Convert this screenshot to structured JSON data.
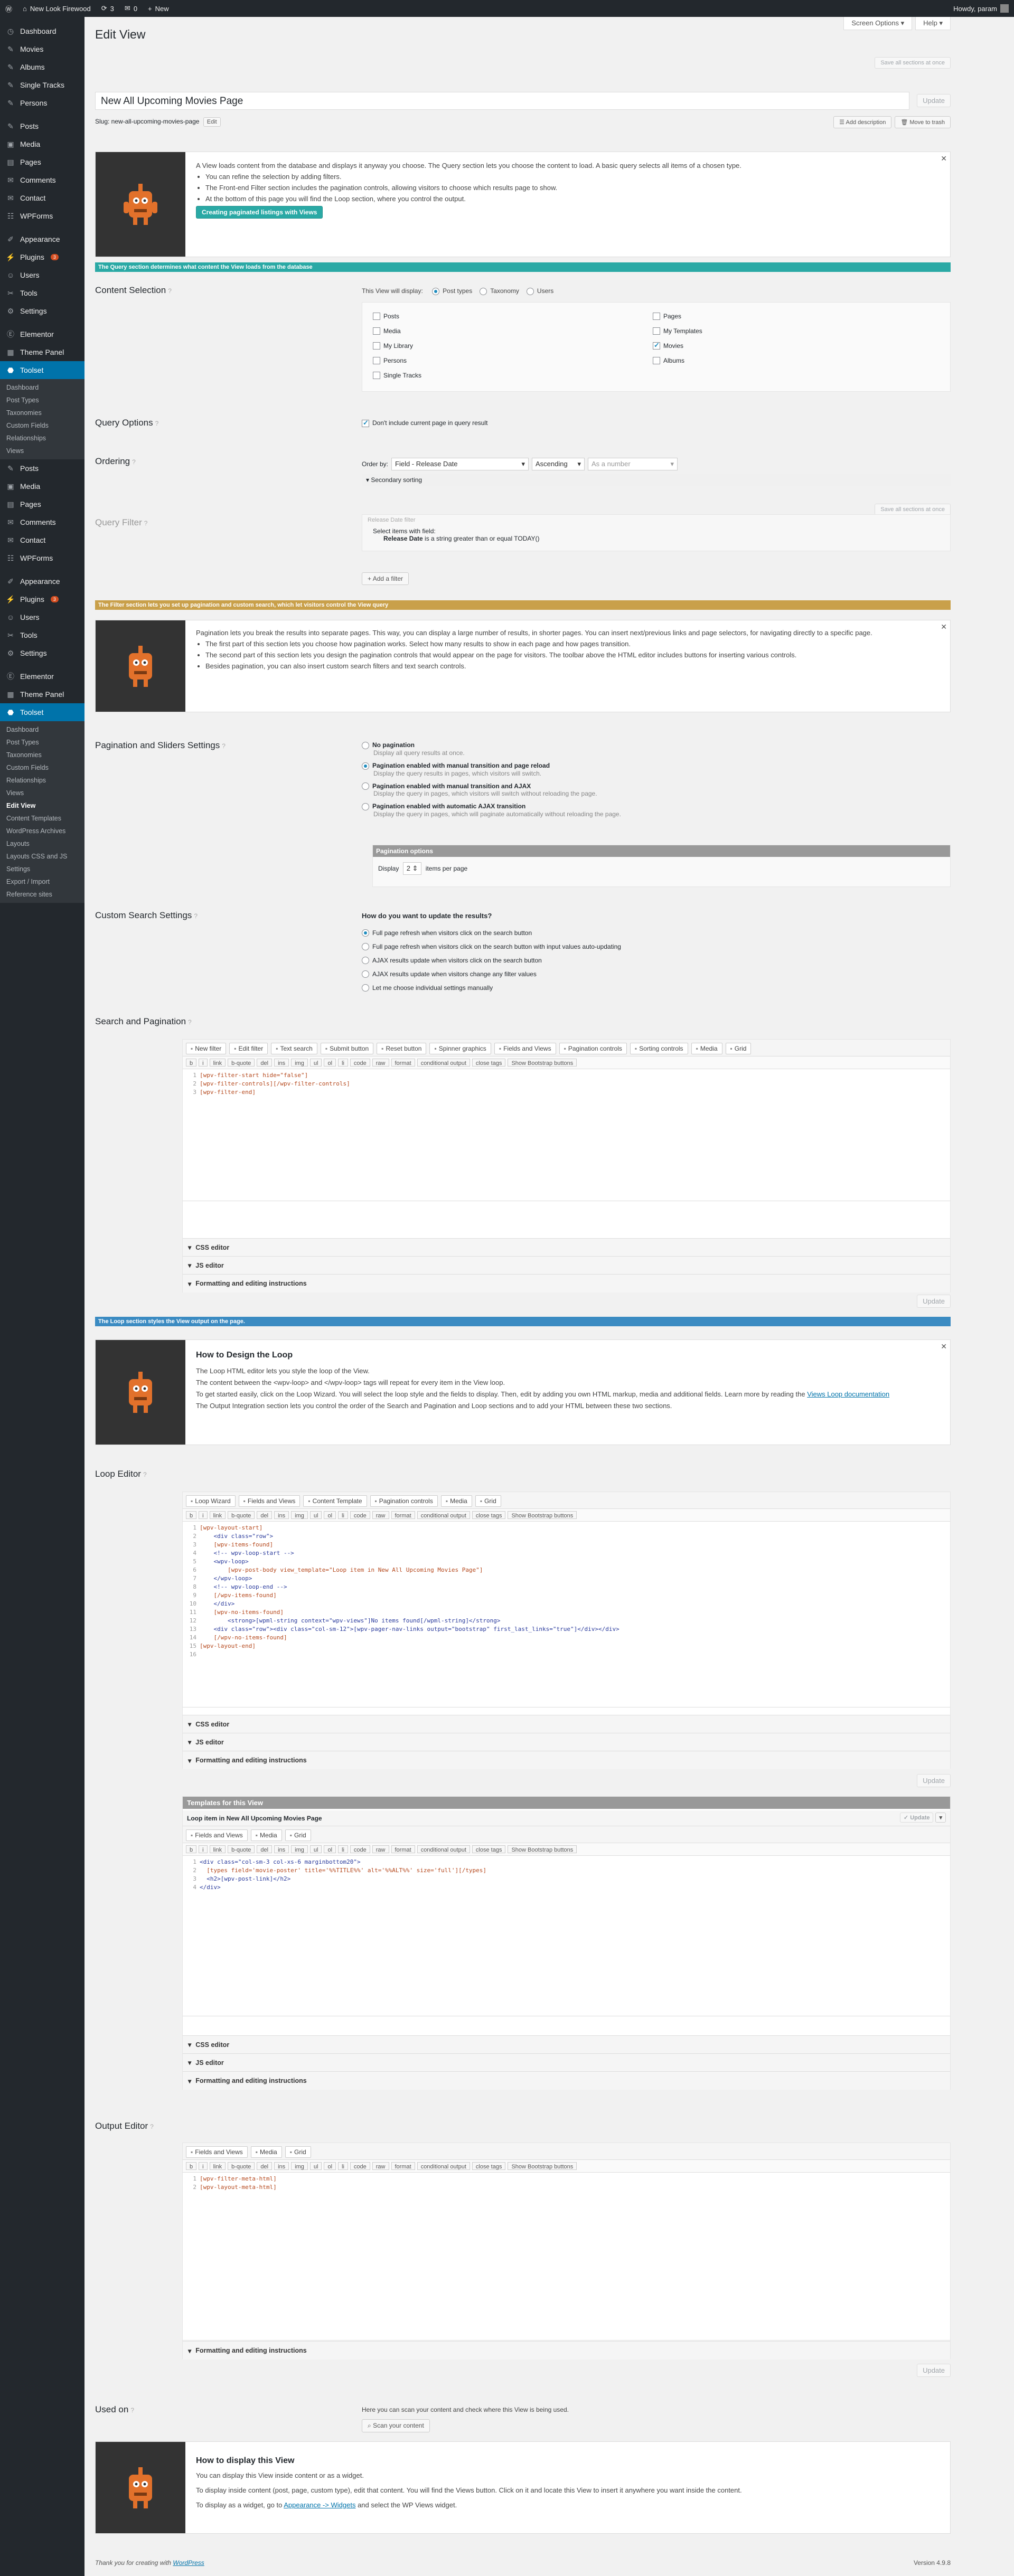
{
  "adminbar": {
    "site": "New Look Firewood",
    "updates": "3",
    "comments": "0",
    "new": "New",
    "howdy": "Howdy, param"
  },
  "menu": {
    "top": [
      {
        "label": "Dashboard",
        "icon": "dashboard-icon"
      },
      {
        "label": "Movies",
        "icon": "pin-icon"
      },
      {
        "label": "Albums",
        "icon": "pin-icon"
      },
      {
        "label": "Single Tracks",
        "icon": "pin-icon"
      },
      {
        "label": "Persons",
        "icon": "pin-icon"
      },
      {
        "label": "Posts",
        "icon": "pin-icon"
      },
      {
        "label": "Media",
        "icon": "media-icon"
      },
      {
        "label": "Pages",
        "icon": "page-icon"
      },
      {
        "label": "Comments",
        "icon": "comment-icon"
      },
      {
        "label": "Contact",
        "icon": "mail-icon"
      },
      {
        "label": "WPForms",
        "icon": "form-icon"
      },
      {
        "label": "Appearance",
        "icon": "brush-icon"
      },
      {
        "label": "Plugins",
        "icon": "plug-icon",
        "badge": "3"
      },
      {
        "label": "Users",
        "icon": "user-icon"
      },
      {
        "label": "Tools",
        "icon": "wrench-icon"
      },
      {
        "label": "Settings",
        "icon": "settings-icon"
      },
      {
        "label": "Elementor",
        "icon": "elementor-icon"
      },
      {
        "label": "Theme Panel",
        "icon": "panel-icon"
      },
      {
        "label": "Toolset",
        "icon": "toolset-icon"
      }
    ],
    "toolset_sub1": [
      "Dashboard",
      "Post Types",
      "Taxonomies",
      "Custom Fields",
      "Relationships",
      "Views"
    ],
    "mid": [
      {
        "label": "Posts",
        "icon": "pin-icon"
      },
      {
        "label": "Media",
        "icon": "media-icon"
      },
      {
        "label": "Pages",
        "icon": "page-icon"
      },
      {
        "label": "Comments",
        "icon": "comment-icon"
      },
      {
        "label": "Contact",
        "icon": "mail-icon"
      },
      {
        "label": "WPForms",
        "icon": "form-icon"
      },
      {
        "label": "Appearance",
        "icon": "brush-icon"
      },
      {
        "label": "Plugins",
        "icon": "plug-icon",
        "badge": "3"
      },
      {
        "label": "Users",
        "icon": "user-icon"
      },
      {
        "label": "Tools",
        "icon": "wrench-icon"
      },
      {
        "label": "Settings",
        "icon": "settings-icon"
      },
      {
        "label": "Elementor",
        "icon": "elementor-icon"
      },
      {
        "label": "Theme Panel",
        "icon": "panel-icon"
      },
      {
        "label": "Toolset",
        "icon": "toolset-icon"
      }
    ],
    "toolset_sub2": [
      "Dashboard",
      "Post Types",
      "Taxonomies",
      "Custom Fields",
      "Relationships",
      "Views",
      "Edit View",
      "Content Templates",
      "WordPress Archives",
      "Layouts",
      "Layouts CSS and JS",
      "Settings",
      "Export / Import",
      "Reference sites"
    ]
  },
  "header": {
    "screen_options": "Screen Options",
    "help": "Help",
    "page_title": "Edit View",
    "save_all": "Save all sections at once",
    "view_title": "New All Upcoming Movies Page",
    "update": "Update",
    "slug_label": "Slug: new-all-upcoming-movies-page",
    "edit": "Edit",
    "add_description": "Add description",
    "move_trash": "Move to trash"
  },
  "intro": {
    "text": "A View loads content from the database and displays it anyway you choose. The Query section lets you choose the content to load. A basic query selects all items of a chosen type.",
    "bullets": [
      "You can refine the selection by adding filters.",
      "The Front-end Filter section includes the pagination controls, allowing visitors to choose which results page to show.",
      "At the bottom of this page you will find the Loop section, where you control the output."
    ],
    "button": "Creating paginated listings with Views"
  },
  "bars": {
    "query": "The Query section determines what content the View loads from the database",
    "filter": "The Filter section lets you set up pagination and custom search, which let visitors control the View query",
    "loop": "The Loop section styles the View output on the page."
  },
  "content_selection": {
    "title": "Content Selection",
    "display_label": "This View will display:",
    "modes": [
      "Post types",
      "Taxonomy",
      "Users"
    ],
    "left": [
      {
        "label": "Posts",
        "on": false
      },
      {
        "label": "Media",
        "on": false
      },
      {
        "label": "My Library",
        "on": false
      },
      {
        "label": "Persons",
        "on": false
      },
      {
        "label": "Single Tracks",
        "on": false
      }
    ],
    "right": [
      {
        "label": "Pages",
        "on": false
      },
      {
        "label": "My Templates",
        "on": false
      },
      {
        "label": "Movies",
        "on": true
      },
      {
        "label": "Albums",
        "on": false
      }
    ]
  },
  "query_options": {
    "title": "Query Options",
    "checkbox": "Don't include current page in query result"
  },
  "ordering": {
    "title": "Ordering",
    "order_by": "Order by:",
    "field": "Field - Release Date",
    "direction": "Ascending",
    "as": "As a number",
    "secondary": "Secondary sorting"
  },
  "query_filter": {
    "title": "Query Filter",
    "save_all": "Save all sections at once",
    "filter_heading": "Release Date filter",
    "select_items": "Select items with field:",
    "filter_field": "Release Date",
    "filter_text": " is a string greater than or equal TODAY()",
    "add_filter": "Add a filter"
  },
  "pagination_help": {
    "text": "Pagination lets you break the results into separate pages. This way, you can display a large number of results, in shorter pages. You can insert next/previous links and page selectors, for navigating directly to a specific page.",
    "bullets": [
      "The first part of this section lets you choose how pagination works. Select how many results to show in each page and how pages transition.",
      "The second part of this section lets you design the pagination controls that would appear on the page for visitors. The toolbar above the HTML editor includes buttons for inserting various controls.",
      "Besides pagination, you can also insert custom search filters and text search controls."
    ]
  },
  "pagination": {
    "title": "Pagination and Sliders Settings",
    "options": [
      {
        "label": "No pagination",
        "desc": "Display all query results at once.",
        "on": false
      },
      {
        "label": "Pagination enabled with manual transition and page reload",
        "desc": "Display the query results in pages, which visitors will switch.",
        "on": true
      },
      {
        "label": "Pagination enabled with manual transition and AJAX",
        "desc": "Display the query in pages, which visitors will switch without reloading the page.",
        "on": false
      },
      {
        "label": "Pagination enabled with automatic AJAX transition",
        "desc": "Display the query in pages, which will paginate automatically without reloading the page.",
        "on": false
      }
    ],
    "options_title": "Pagination options",
    "display": "Display",
    "per_page": "2",
    "items_per_page": "items per page"
  },
  "custom_search": {
    "title": "Custom Search Settings",
    "question": "How do you want to update the results?",
    "options": [
      {
        "label": "Full page refresh when visitors click on the search button",
        "on": true
      },
      {
        "label": "Full page refresh when visitors click on the search button with input values auto-updating",
        "on": false
      },
      {
        "label": "AJAX results update when visitors click on the search button",
        "on": false
      },
      {
        "label": "AJAX results update when visitors change any filter values",
        "on": false
      },
      {
        "label": "Let me choose individual settings manually",
        "on": false
      }
    ]
  },
  "search_pagination": {
    "title": "Search and Pagination",
    "toolbar": [
      "New filter",
      "Edit filter",
      "Text search",
      "Submit button",
      "Reset button",
      "Spinner graphics",
      "Fields and Views",
      "Pagination controls",
      "Sorting controls",
      "Media",
      "Grid"
    ],
    "quicktags": [
      "b",
      "i",
      "link",
      "b-quote",
      "del",
      "ins",
      "img",
      "ul",
      "ol",
      "li",
      "code",
      "raw",
      "format",
      "conditional output",
      "close tags",
      "Show Bootstrap buttons"
    ],
    "code": [
      "[wpv-filter-start hide=\"false\"]",
      "[wpv-filter-controls][/wpv-filter-controls]",
      "[wpv-filter-end]"
    ],
    "css": "CSS editor",
    "js": "JS editor",
    "fmt": "Formatting and editing instructions",
    "update": "Update"
  },
  "loop_help": {
    "title": "How to Design the Loop",
    "p1": "The Loop HTML editor lets you style the loop of the View.",
    "p2": "The content between the <wpv-loop> and </wpv-loop> tags will repeat for every item in the View loop.",
    "p3": "To get started easily, click on the Loop Wizard. You will select the loop style and the fields to display. Then, edit by adding you own HTML markup, media and additional fields. Learn more by reading the",
    "link": "Views Loop documentation",
    "p4": "The Output Integration section lets you control the order of the Search and Pagination and Loop sections and to add your HTML between these two sections."
  },
  "loop_editor": {
    "title": "Loop Editor",
    "toolbar": [
      "Loop Wizard",
      "Fields and Views",
      "Content Template",
      "Pagination controls",
      "Media",
      "Grid"
    ],
    "code": [
      "[wpv-layout-start]",
      "\t<div class=\"row\">",
      "\t[wpv-items-found]",
      "\t<!-- wpv-loop-start -->",
      "\t<wpv-loop>",
      "\t\t[wpv-post-body view_template=\"Loop item in New All Upcoming Movies Page\"]",
      "\t</wpv-loop>",
      "\t<!-- wpv-loop-end -->",
      "\t[/wpv-items-found]",
      "\t</div>",
      "\t[wpv-no-items-found]",
      "\t\t<strong>[wpml-string context=\"wpv-views\"]No items found[/wpml-string]</strong>",
      "\t<div class=\"row\"><div class=\"col-sm-12\">[wpv-pager-nav-links output=\"bootstrap\" first_last_links=\"true\"]</div></div>",
      "\t[/wpv-no-items-found]",
      "[wpv-layout-end]",
      ""
    ]
  },
  "templates": {
    "title": "Templates for this View",
    "item": "Loop item in New All Upcoming Movies Page",
    "update": "Update",
    "toolbar": [
      "Fields and Views",
      "Media",
      "Grid"
    ],
    "code": [
      "<div class=\"col-sm-3 col-xs-6 marginbottom20\">",
      "  [types field='movie-poster' title='%%TITLE%%' alt='%%ALT%%' size='full'][/types]",
      "  <h2>[wpv-post-link]</h2>",
      "</div>"
    ]
  },
  "output_editor": {
    "title": "Output Editor",
    "toolbar": [
      "Fields and Views",
      "Media",
      "Grid"
    ],
    "code": [
      "[wpv-filter-meta-html]",
      "[wpv-layout-meta-html]"
    ]
  },
  "used_on": {
    "title": "Used on",
    "text": "Here you can scan your content and check where this View is being used.",
    "button": "Scan your content"
  },
  "display_help": {
    "title": "How to display this View",
    "p1": "You can display this View inside content or as a widget.",
    "p2": "To display inside content (post, page, custom type), edit that content. You will find the Views button. Click on it and locate this View to insert it anywhere you want inside the content.",
    "p3a": "To display as a widget, go to",
    "link": "Appearance -> Widgets",
    "p3b": "and select the WP Views widget."
  },
  "footer": {
    "thanks": "Thank you for creating with",
    "wp": "WordPress",
    "version": "Version 4.9.8"
  },
  "colors": {
    "bar_teal": "#2aa9a5",
    "bar_orange": "#c9a04a",
    "bar_blue": "#3b8bc2",
    "admin_blue": "#0073aa"
  }
}
